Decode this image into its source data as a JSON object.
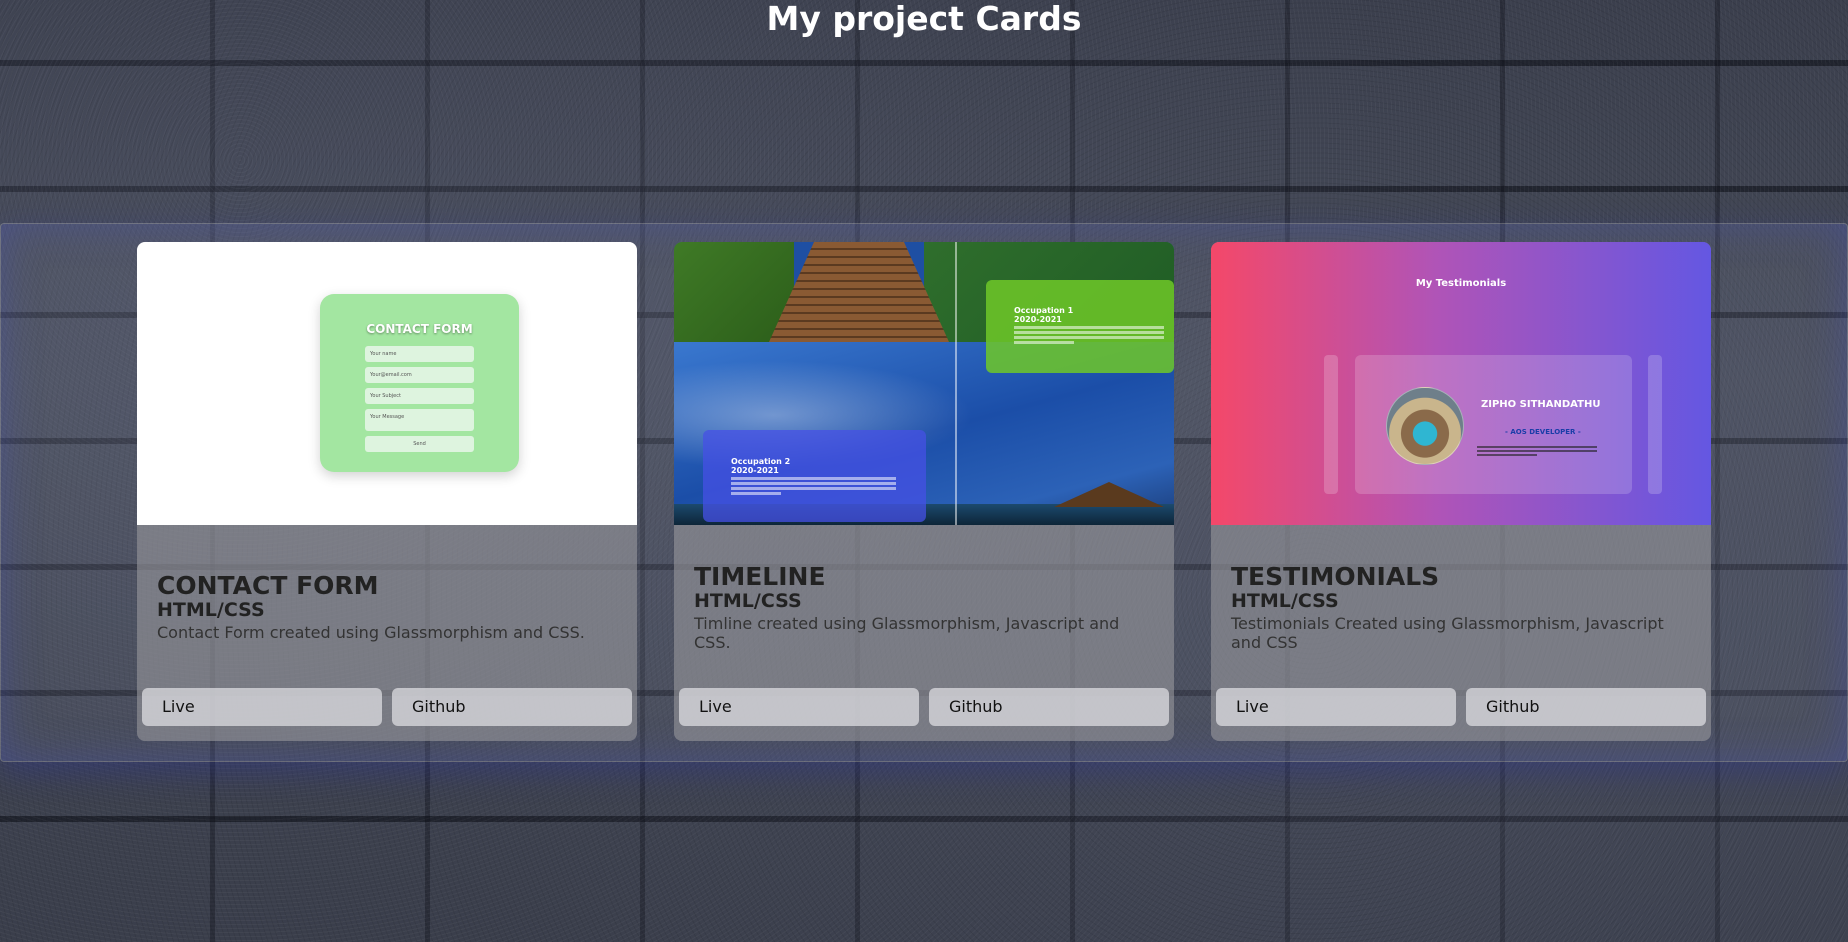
{
  "page": {
    "title": "My project Cards"
  },
  "cards": [
    {
      "title": "CONTACT FORM",
      "tech": "HTML/CSS",
      "description": "Contact Form created using Glassmorphism and CSS.",
      "live_label": "Live",
      "github_label": "Github",
      "preview": {
        "heading": "CONTACT FORM",
        "fields": [
          "Your name",
          "Your@email.com",
          "Your Subject",
          "Your Message"
        ],
        "submit_label": "Send"
      }
    },
    {
      "title": "TIMELINE",
      "tech": "HTML/CSS",
      "description": "Timline created using Glassmorphism, Javascript and CSS.",
      "live_label": "Live",
      "github_label": "Github",
      "preview": {
        "entries": [
          {
            "heading": "Occupation 1",
            "years": "2020-2021"
          },
          {
            "heading": "Occupation 2",
            "years": "2020-2021"
          }
        ]
      }
    },
    {
      "title": "TESTIMONIALS",
      "tech": "HTML/CSS",
      "description": "Testimonials Created using Glassmorphism, Javascript and CSS",
      "live_label": "Live",
      "github_label": "Github",
      "preview": {
        "heading": "My Testimonials",
        "name": "ZIPHO SITHANDATHU",
        "role": "- AOS DEVELOPER -"
      }
    }
  ],
  "colors": {
    "contact_form_green": "#a3e6a1",
    "timeline_green": "#6ec828",
    "timeline_blue": "#4650e6",
    "testimonials_pink": "#f44869",
    "testimonials_purple": "#6457e2"
  }
}
